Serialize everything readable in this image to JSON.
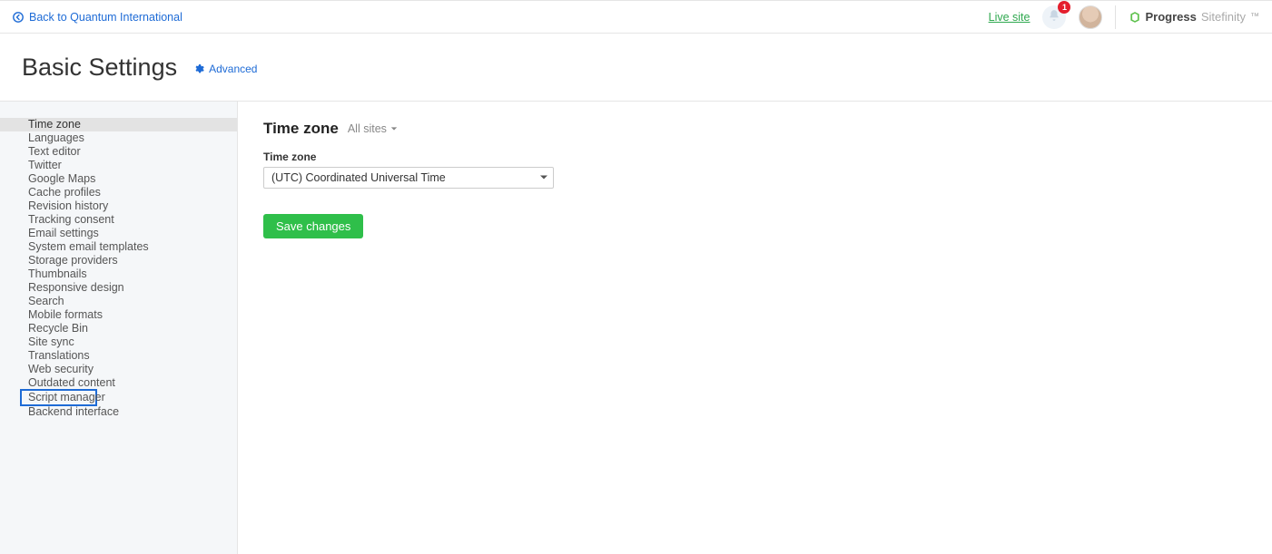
{
  "topbar": {
    "back_label": "Back to Quantum International",
    "live_site_label": "Live site",
    "notification_count": "1",
    "brand_primary": "Progress",
    "brand_secondary": "Sitefinity"
  },
  "header": {
    "title": "Basic Settings",
    "advanced_label": "Advanced"
  },
  "sidebar": {
    "items": [
      {
        "label": "Time zone",
        "state": "active"
      },
      {
        "label": "Languages"
      },
      {
        "label": "Text editor"
      },
      {
        "label": "Twitter"
      },
      {
        "label": "Google Maps"
      },
      {
        "label": "Cache profiles"
      },
      {
        "label": "Revision history"
      },
      {
        "label": "Tracking consent"
      },
      {
        "label": "Email settings"
      },
      {
        "label": "System email templates"
      },
      {
        "label": "Storage providers"
      },
      {
        "label": "Thumbnails"
      },
      {
        "label": "Responsive design"
      },
      {
        "label": "Search"
      },
      {
        "label": "Mobile formats"
      },
      {
        "label": "Recycle Bin"
      },
      {
        "label": "Site sync"
      },
      {
        "label": "Translations"
      },
      {
        "label": "Web security"
      },
      {
        "label": "Outdated content"
      },
      {
        "label": "Script manager",
        "state": "highlighted"
      },
      {
        "label": "Backend interface"
      }
    ]
  },
  "main": {
    "section_title": "Time zone",
    "scope_label": "All sites",
    "field_label": "Time zone",
    "selected_value": "(UTC) Coordinated Universal Time",
    "save_label": "Save changes"
  }
}
